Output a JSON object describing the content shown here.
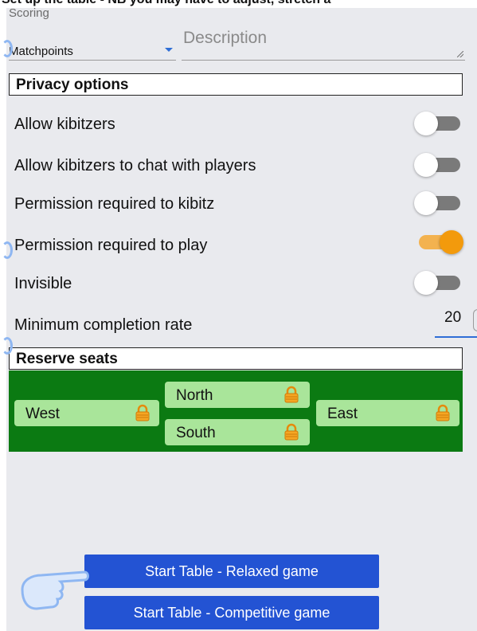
{
  "header_cut": {
    "text": "Set up the table - NB you may have to adjust, stretch a"
  },
  "scoring": {
    "label": "Scoring",
    "value": "Matchpoints"
  },
  "description": {
    "placeholder": "Description"
  },
  "privacy": {
    "heading": "Privacy options",
    "options": [
      {
        "label": "Allow kibitzers",
        "on": false
      },
      {
        "label": "Allow kibitzers to chat with players",
        "on": false
      },
      {
        "label": "Permission required to kibitz",
        "on": false
      },
      {
        "label": "Permission required to play",
        "on": true
      },
      {
        "label": "Invisible",
        "on": false
      }
    ],
    "min_completion": {
      "label": "Minimum completion rate",
      "value": "20"
    }
  },
  "reserve": {
    "heading": "Reserve seats",
    "seats": {
      "west": "West",
      "north": "North",
      "south": "South",
      "east": "East"
    }
  },
  "buttons": {
    "relaxed": "Start Table - Relaxed game",
    "competitive": "Start Table - Competitive game"
  },
  "colors": {
    "green": "#0b7a12",
    "seat": "#a9e59a",
    "button": "#2353d3",
    "toggle_on": "#f39a0c"
  }
}
